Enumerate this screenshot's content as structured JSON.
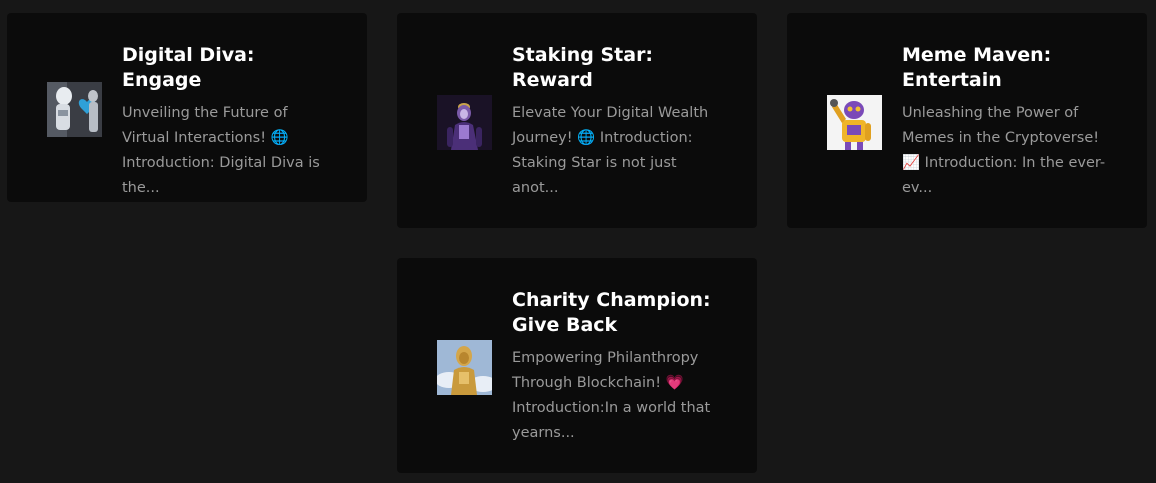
{
  "cards": [
    {
      "title": "Digital Diva: Engage",
      "description": "Unveiling the Future of Virtual Interactions! 🌐 Introduction: Digital Diva is the...",
      "image_icon": "humanoid-robot-heart-image"
    },
    {
      "title": "Staking Star: Reward",
      "description": "Elevate Your Digital Wealth Journey! 🌐 Introduction: Staking Star is not just anot...",
      "image_icon": "purple-android-image"
    },
    {
      "title": "Meme Maven: Entertain",
      "description": "Unleashing the Power of Memes in the Cryptoverse! 📈 Introduction: In the ever-ev...",
      "image_icon": "yellow-robot-waving-image"
    },
    {
      "title": "Charity Champion: Give Back",
      "description": "Empowering Philanthropy Through Blockchain! 💗 Introduction:In a world that yearns...",
      "image_icon": "golden-robot-image"
    }
  ],
  "colors": {
    "page_bg": "#171717",
    "card_bg": "#0b0b0b",
    "title": "#ffffff",
    "description": "#9a9a9a"
  }
}
